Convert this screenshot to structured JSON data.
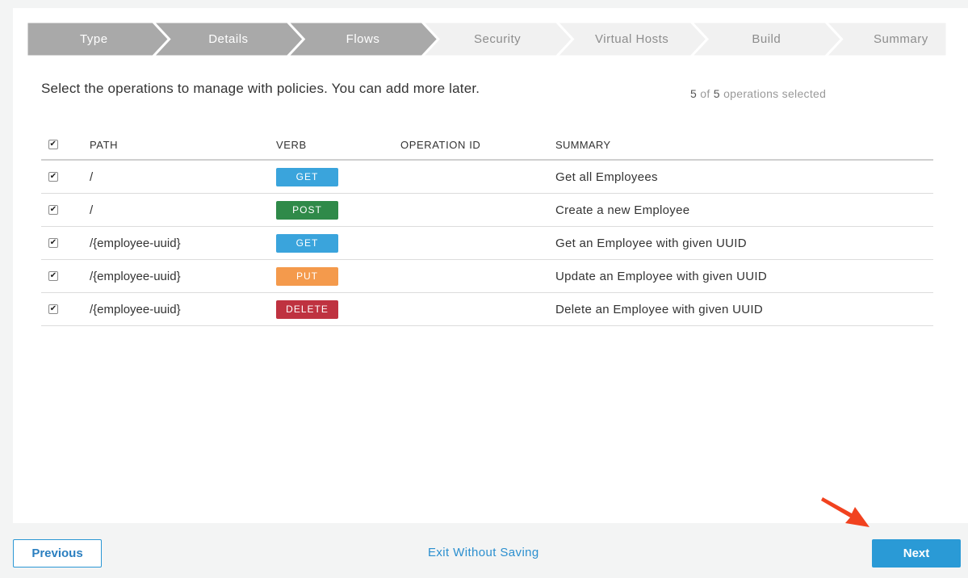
{
  "wizard": {
    "steps": [
      {
        "label": "Type",
        "state": "done"
      },
      {
        "label": "Details",
        "state": "done"
      },
      {
        "label": "Flows",
        "state": "done"
      },
      {
        "label": "Security",
        "state": "todo"
      },
      {
        "label": "Virtual Hosts",
        "state": "todo"
      },
      {
        "label": "Build",
        "state": "todo"
      },
      {
        "label": "Summary",
        "state": "todo"
      }
    ]
  },
  "intro": "Select the operations to manage with policies. You can add more later.",
  "selection": {
    "selected": "5",
    "of_word": "of",
    "total": "5",
    "suffix": "operations selected"
  },
  "table": {
    "headers": {
      "path": "PATH",
      "verb": "VERB",
      "operation_id": "OPERATION ID",
      "summary": "SUMMARY"
    },
    "rows": [
      {
        "path": "/",
        "verb": "GET",
        "operation_id": "",
        "summary": "Get all Employees"
      },
      {
        "path": "/",
        "verb": "POST",
        "operation_id": "",
        "summary": "Create a new Employee"
      },
      {
        "path": "/{employee-uuid}",
        "verb": "GET",
        "operation_id": "",
        "summary": "Get an Employee with given UUID"
      },
      {
        "path": "/{employee-uuid}",
        "verb": "PUT",
        "operation_id": "",
        "summary": "Update an Employee with given UUID"
      },
      {
        "path": "/{employee-uuid}",
        "verb": "DELETE",
        "operation_id": "",
        "summary": "Delete an Employee with given UUID"
      }
    ]
  },
  "verb_colors": {
    "GET": "#3aa4dc",
    "POST": "#2f8a49",
    "PUT": "#f49a4c",
    "DELETE": "#bf3240"
  },
  "footer": {
    "previous": "Previous",
    "exit": "Exit Without Saving",
    "next": "Next"
  },
  "colors": {
    "step_done": "#a9a9a9",
    "step_todo": "#f1f1f1",
    "accent": "#2a9ad6",
    "arrow": "#f1421f"
  }
}
